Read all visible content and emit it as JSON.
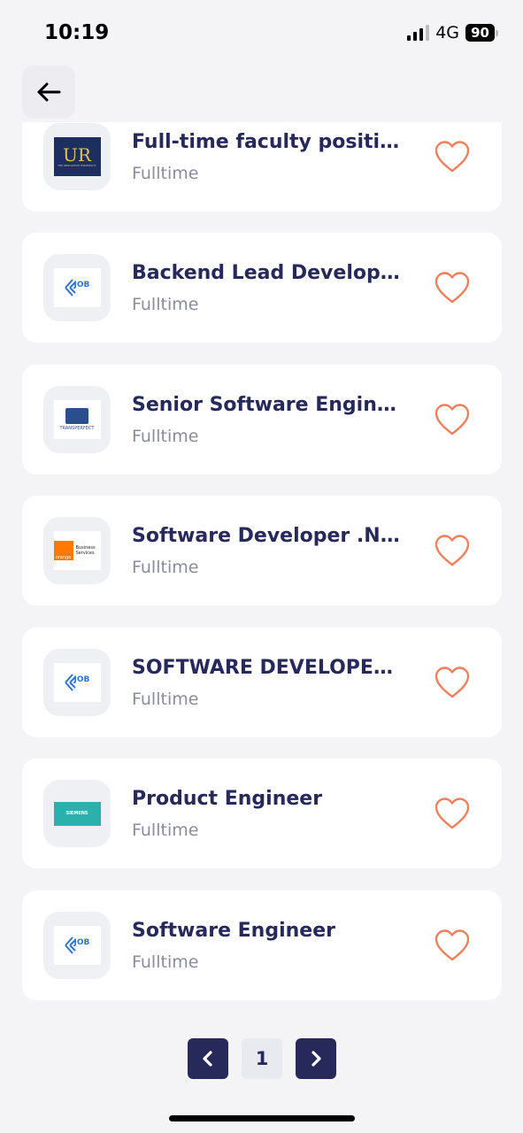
{
  "status_bar": {
    "time": "10:19",
    "network": "4G",
    "battery": "90"
  },
  "header": {
    "back_icon": "arrow-left-icon"
  },
  "jobs": [
    {
      "title": "Full-time faculty positio…",
      "type": "Fulltime",
      "logo": "ur-innovative-university-logo",
      "logo_text": "UR",
      "logo_subtext": "THE INNOVATIVE UNIVERSITY"
    },
    {
      "title": "Backend Lead Developer",
      "type": "Fulltime",
      "logo": "job-logo",
      "logo_text": "JOB"
    },
    {
      "title": "Senior Software Enginee…",
      "type": "Fulltime",
      "logo": "transperfect-logo",
      "logo_text": "TRANSPERFECT"
    },
    {
      "title": "Software Developer .NET…",
      "type": "Fulltime",
      "logo": "orange-business-services-logo",
      "logo_text": "orange",
      "logo_subtext": "Business Services"
    },
    {
      "title": "SOFTWARE DEVELOPER…",
      "type": "Fulltime",
      "logo": "job-logo",
      "logo_text": "JOB"
    },
    {
      "title": "Product Engineer",
      "type": "Fulltime",
      "logo": "siemens-logo",
      "logo_text": "SIEMENS"
    },
    {
      "title": "Software Engineer",
      "type": "Fulltime",
      "logo": "job-logo",
      "logo_text": "JOB"
    }
  ],
  "pagination": {
    "current_page": "1",
    "prev_icon": "chevron-left-icon",
    "next_icon": "chevron-right-icon"
  },
  "colors": {
    "accent": "#27295a",
    "heart": "#f07f5c",
    "subtitle": "#8a8c9c",
    "background": "#f4f4f7"
  }
}
